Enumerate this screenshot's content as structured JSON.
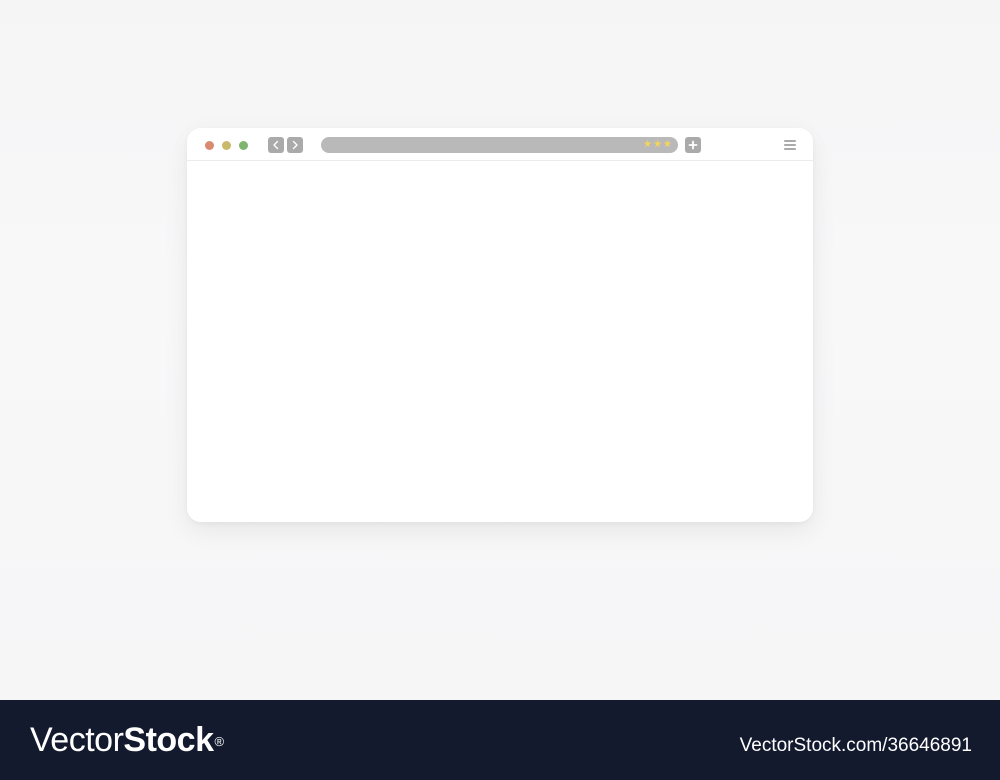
{
  "colors": {
    "dot_red": "#d98b6f",
    "dot_yellow": "#c9b96b",
    "dot_green": "#7fb56f",
    "control_gray": "#aaaaaa",
    "address_bar": "#b9b9b9",
    "star_yellow": "#f6d35a",
    "footer_bg": "#141a2e"
  },
  "browser": {
    "window_controls": [
      "close-dot",
      "minimize-dot",
      "maximize-dot"
    ],
    "nav": {
      "back_icon": "chevron-left-icon",
      "forward_icon": "chevron-right-icon"
    },
    "address_bar": {
      "value": "",
      "stars": [
        "★",
        "★",
        "★"
      ]
    },
    "new_tab_icon": "plus-icon",
    "menu_icon": "hamburger-menu-icon"
  },
  "footer": {
    "brand_light": "Vector",
    "brand_bold": "Stock",
    "brand_mark": "®",
    "image_id": "VectorStock.com/36646891"
  }
}
